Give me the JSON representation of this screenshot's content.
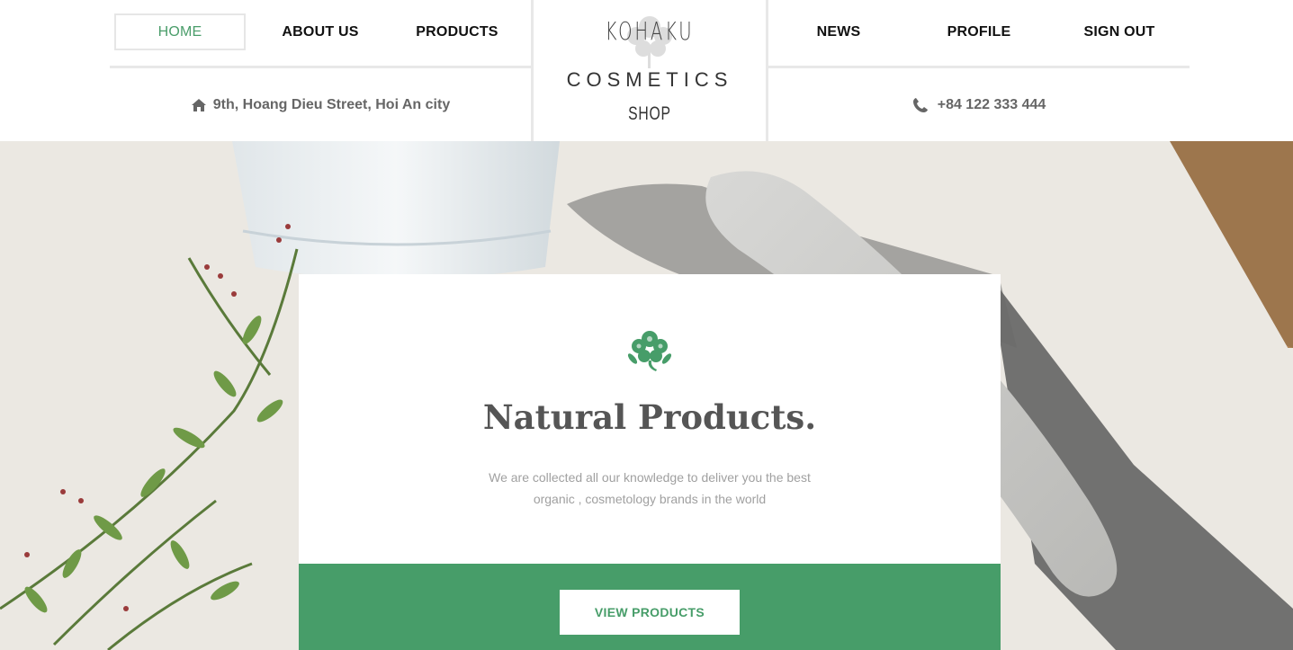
{
  "nav": {
    "left": [
      {
        "label": "HOME",
        "active": true
      },
      {
        "label": "ABOUT US"
      },
      {
        "label": "PRODUCTS"
      }
    ],
    "right": [
      {
        "label": "NEWS"
      },
      {
        "label": "PROFILE"
      },
      {
        "label": "SIGN OUT"
      }
    ]
  },
  "contact": {
    "address": "9th, Hoang Dieu Street, Hoi An city",
    "address_icon": "home-icon",
    "phone": "+84 122 333 444",
    "phone_icon": "phone-icon"
  },
  "logo": {
    "brand": "KOHAKU",
    "line2": "COSMETICS",
    "line3": "SHOP",
    "icon": "flower-icon"
  },
  "hero": {
    "icon": "flower-icon",
    "title": "Natural Products.",
    "description": "We are collected all our knowledge to deliver you the best organic , cosmetology brands in the world",
    "button_label": "VIEW PRODUCTS"
  },
  "colors": {
    "accent": "#479d69",
    "active_nav": "#4a9d6a",
    "text_dark": "#111111",
    "text_muted": "#a0a0a0"
  }
}
